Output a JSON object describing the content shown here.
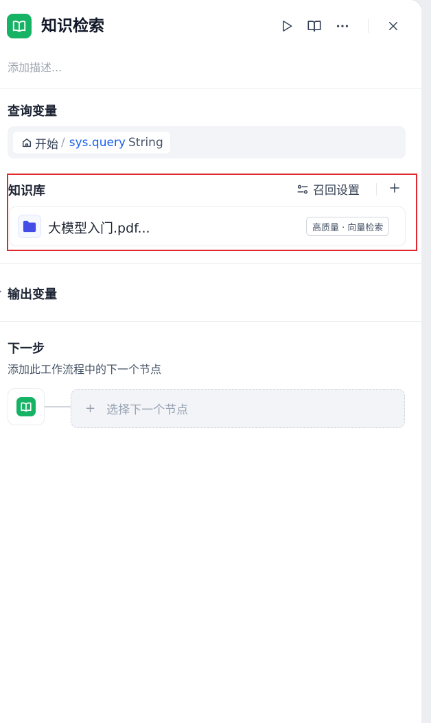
{
  "header": {
    "title": "知识检索",
    "app_icon": "book-open-icon",
    "icons": [
      "play-icon",
      "book-icon",
      "more-icon",
      "close-icon"
    ]
  },
  "description_placeholder": "添加描述...",
  "query": {
    "title": "查询变量",
    "source_icon": "home-icon",
    "source": "开始",
    "separator": "/",
    "variable": "sys.query",
    "type": "String"
  },
  "knowledge": {
    "title": "知识库",
    "recall_label": "召回设置",
    "item": {
      "icon": "folder-icon",
      "name": "大模型入门.pdf...",
      "badge": "高质量 · 向量检索"
    }
  },
  "output": {
    "title": "输出变量"
  },
  "next_step": {
    "title": "下一步",
    "description": "添加此工作流程中的下一个节点",
    "select_label": "选择下一个节点",
    "plus": "+"
  },
  "colors": {
    "brand_green": "#16b364",
    "link_blue": "#155eef",
    "folder_blue": "#444ce7",
    "highlight_red": "#e0262f"
  }
}
